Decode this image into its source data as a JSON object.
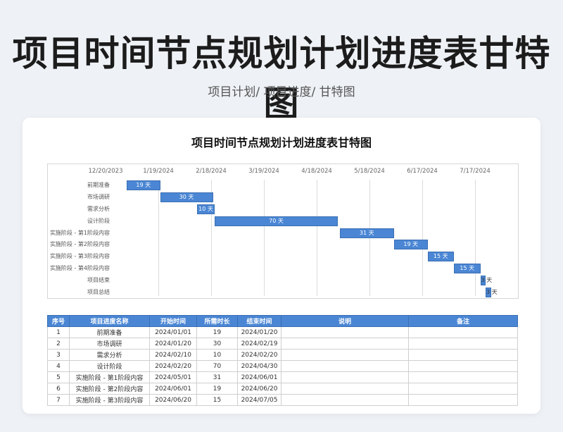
{
  "page": {
    "title": "项目时间节点规划计划进度表甘特图",
    "breadcrumb": "项目计划/  项目进度/  甘特图"
  },
  "sheet": {
    "title": "项目时间节点规划计划进度表甘特图"
  },
  "chart_data": {
    "type": "bar",
    "x_ticks": [
      "12/20/2023",
      "1/19/2024",
      "2/18/2024",
      "3/19/2024",
      "4/18/2024",
      "5/18/2024",
      "6/17/2024",
      "7/17/2024"
    ],
    "tasks": [
      {
        "name": "前期准备",
        "start": "2024-01-01",
        "duration": 19,
        "label": "19 天"
      },
      {
        "name": "市场调研",
        "start": "2024-01-20",
        "duration": 30,
        "label": "30 天"
      },
      {
        "name": "需求分析",
        "start": "2024-02-10",
        "duration": 10,
        "label": "10 天"
      },
      {
        "name": "设计阶段",
        "start": "2024-02-20",
        "duration": 70,
        "label": "70 天"
      },
      {
        "name": "实施阶段 - 第1阶段内容",
        "start": "2024-05-01",
        "duration": 31,
        "label": "31 天"
      },
      {
        "name": "实施阶段 - 第2阶段内容",
        "start": "2024-06-01",
        "duration": 19,
        "label": "19 天"
      },
      {
        "name": "实施阶段 - 第3阶段内容",
        "start": "2024-06-20",
        "duration": 15,
        "label": "15 天"
      },
      {
        "name": "实施阶段 - 第4阶段内容",
        "start": "2024-07-05",
        "duration": 15,
        "label": "15 天"
      },
      {
        "name": "项目结束",
        "start": "2024-07-20",
        "duration": 3,
        "label": "3 天"
      },
      {
        "name": "项目总结",
        "start": "2024-07-23",
        "duration": 3,
        "label": "3 天"
      }
    ],
    "xlim": [
      "2023-12-20",
      "2024-08-01"
    ]
  },
  "table": {
    "headers": [
      "序号",
      "项目进度名称",
      "开始时间",
      "所需时长",
      "结束时间",
      "说明",
      "备注"
    ],
    "rows": [
      [
        "1",
        "前期准备",
        "2024/01/01",
        "19",
        "2024/01/20",
        "",
        ""
      ],
      [
        "2",
        "市场调研",
        "2024/01/20",
        "30",
        "2024/02/19",
        "",
        ""
      ],
      [
        "3",
        "需求分析",
        "2024/02/10",
        "10",
        "2024/02/20",
        "",
        ""
      ],
      [
        "4",
        "设计阶段",
        "2024/02/20",
        "70",
        "2024/04/30",
        "",
        ""
      ],
      [
        "5",
        "实施阶段 - 第1阶段内容",
        "2024/05/01",
        "31",
        "2024/06/01",
        "",
        ""
      ],
      [
        "6",
        "实施阶段 - 第2阶段内容",
        "2024/06/01",
        "19",
        "2024/06/20",
        "",
        ""
      ],
      [
        "7",
        "实施阶段 - 第3阶段内容",
        "2024/06/20",
        "15",
        "2024/07/05",
        "",
        ""
      ]
    ]
  }
}
